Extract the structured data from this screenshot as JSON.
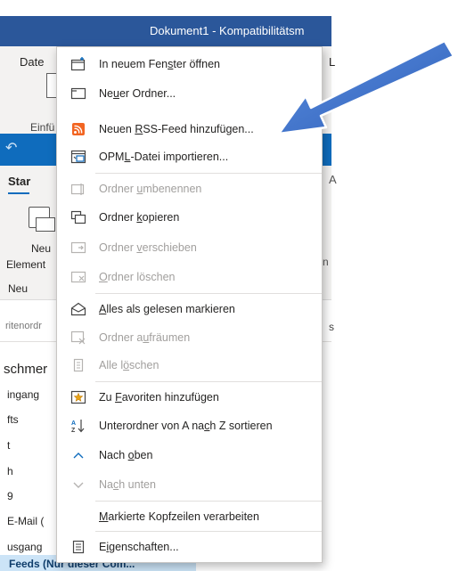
{
  "word": {
    "title": "Dokument1  -  Kompatibilitätsm",
    "tab_left": "Date",
    "tab_right": "L",
    "insert_label": "Einfü"
  },
  "outlook": {
    "undo_glyph": "↶",
    "tab_start": "Star",
    "tab_right": "A",
    "new_item_line1": "Neu",
    "new_item_line2": "Element",
    "group_new": "Neu",
    "ribbon_right": "n",
    "favorites_label": "ritenordr",
    "right_pane_char": "s",
    "folder_header": "schmer",
    "folders": [
      "ingang",
      "fts",
      "t",
      "h",
      "9",
      "E-Mail (",
      "usgang"
    ],
    "feeds_label": "Feeds (Nur dieser Com..."
  },
  "menu": {
    "items": [
      {
        "pre": "In neuem Fen",
        "ul": "s",
        "post": "ter öffnen",
        "icon": "new-window-icon",
        "disabled": false
      },
      {
        "pre": "Ne",
        "ul": "u",
        "post": "er Ordner...",
        "icon": "new-folder-icon",
        "disabled": false
      },
      {
        "pre": "Neuen ",
        "ul": "R",
        "post": "SS-Feed hinzufügen...",
        "icon": "rss-feed-icon",
        "disabled": false
      },
      {
        "pre": "OPM",
        "ul": "L",
        "post": "-Datei importieren...",
        "icon": "opml-import-icon",
        "disabled": false
      },
      {
        "pre": "Ordner ",
        "ul": "u",
        "post": "mbenennen",
        "icon": "rename-folder-icon",
        "disabled": true
      },
      {
        "pre": "Ordner ",
        "ul": "k",
        "post": "opieren",
        "icon": "copy-folder-icon",
        "disabled": false
      },
      {
        "pre": "Ordner ",
        "ul": "v",
        "post": "erschieben",
        "icon": "move-folder-icon",
        "disabled": true
      },
      {
        "pre": "",
        "ul": "O",
        "post": "rdner löschen",
        "icon": "delete-folder-icon",
        "disabled": true
      },
      {
        "pre": "",
        "ul": "A",
        "post": "lles als gelesen markieren",
        "icon": "mark-all-read-icon",
        "disabled": false
      },
      {
        "pre": "Ordner a",
        "ul": "u",
        "post": "fräumen",
        "icon": "clean-up-folder-icon",
        "disabled": true
      },
      {
        "pre": "Alle l",
        "ul": "ö",
        "post": "schen",
        "icon": "delete-all-icon",
        "disabled": true
      },
      {
        "pre": "Zu ",
        "ul": "F",
        "post": "avoriten hinzufügen",
        "icon": "add-favorite-icon",
        "disabled": false
      },
      {
        "pre": "Unterordner von A na",
        "ul": "c",
        "post": "h Z sortieren",
        "icon": "sort-az-icon",
        "disabled": false
      },
      {
        "pre": "Nach ",
        "ul": "o",
        "post": "ben",
        "icon": "move-up-icon",
        "disabled": false
      },
      {
        "pre": "Na",
        "ul": "c",
        "post": "h unten",
        "icon": "move-down-icon",
        "disabled": true
      },
      {
        "pre": "",
        "ul": "M",
        "post": "arkierte Kopfzeilen verarbeiten",
        "icon": "",
        "disabled": false
      },
      {
        "pre": "E",
        "ul": "i",
        "post": "genschaften...",
        "icon": "properties-icon",
        "disabled": false
      }
    ]
  },
  "colors": {
    "word_blue": "#2b579a",
    "outlook_blue": "#0f6cbd",
    "arrow_blue": "#3a6ec5",
    "rss_orange": "#f26522",
    "favorite_gold": "#e8a317",
    "selection_blue": "#cce4f7"
  }
}
